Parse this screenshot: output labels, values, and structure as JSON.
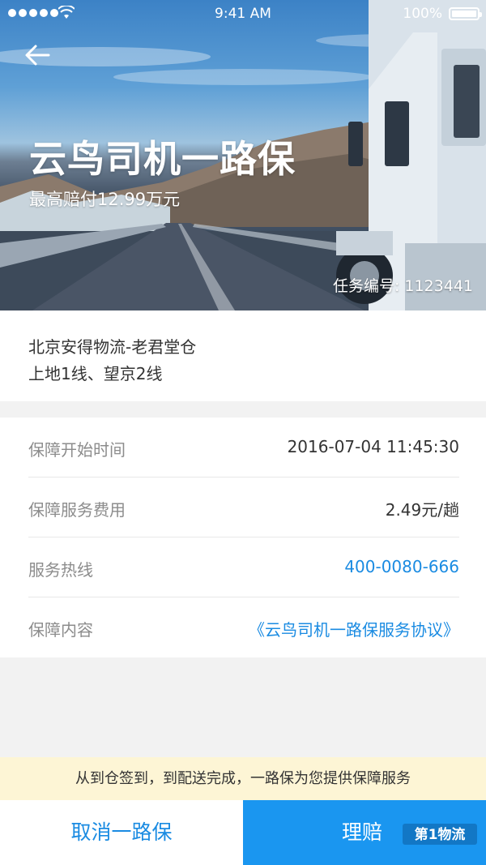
{
  "status_bar": {
    "time": "9:41 AM",
    "battery": "100%"
  },
  "hero": {
    "title": "云鸟司机一路保",
    "subtitle": "最高赔付12.99万元",
    "task_number": "任务编号: 1123441"
  },
  "route": {
    "line1": "北京安得物流-老君堂仓",
    "line2": "上地1线、望京2线"
  },
  "details": [
    {
      "label": "保障开始时间",
      "value": "2016-07-04 11:45:30"
    },
    {
      "label": "保障服务费用",
      "value": "2.49元/趟"
    },
    {
      "label": "服务热线",
      "value": "400-0080-666"
    },
    {
      "label": "保障内容",
      "value": "《云鸟司机一路保服务协议》"
    }
  ],
  "notice": "从到仓签到，到配送完成，一路保为您提供保障服务",
  "actions": {
    "cancel": "取消一路保",
    "claim": "理赔"
  },
  "watermark": "第1物流",
  "colors": {
    "link": "#1a8be2",
    "primary_button": "#1a96f0",
    "notice_bg": "#fdf5d5"
  }
}
